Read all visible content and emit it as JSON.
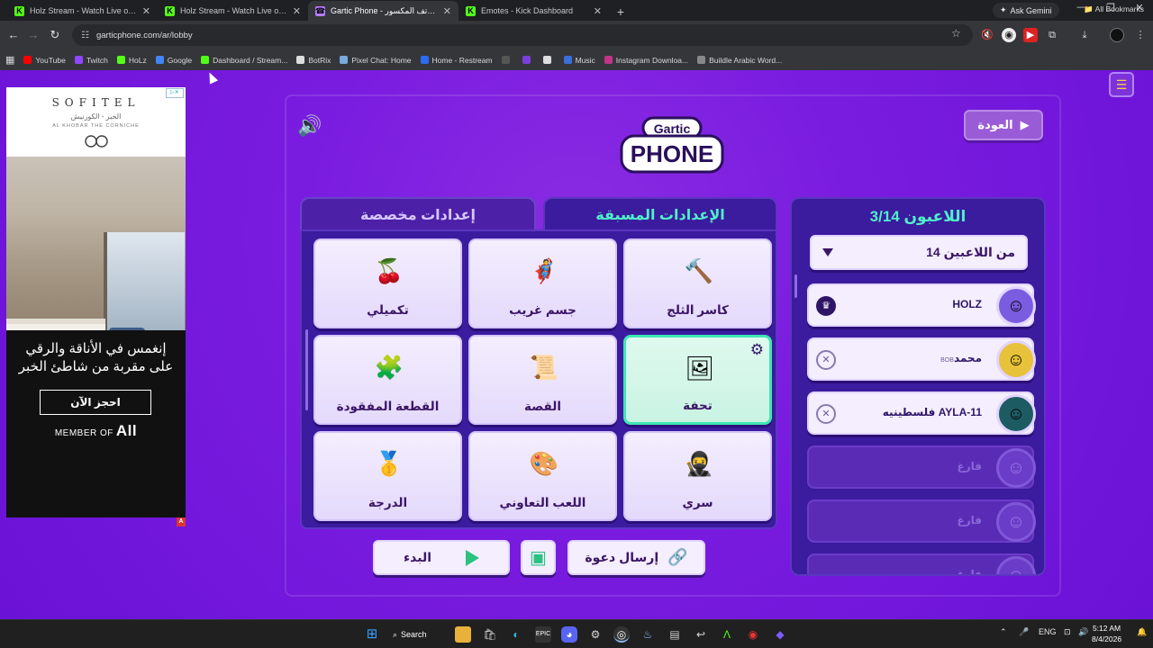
{
  "browser": {
    "tabs": [
      {
        "title": "Holz Stream - Watch Live on Ki",
        "favicon_color": "#53fc18",
        "glyph": "K",
        "active": false
      },
      {
        "title": "Holz Stream - Watch Live on Ki",
        "favicon_color": "#53fc18",
        "glyph": "K",
        "active": false
      },
      {
        "title": "Gartic Phone - الهاتف المكسور -",
        "favicon_color": "#b67cff",
        "glyph": "☎",
        "active": true
      },
      {
        "title": "Emotes - Kick Dashboard",
        "favicon_color": "#53fc18",
        "glyph": "K",
        "active": false
      }
    ],
    "new_tab": "+",
    "ask_gemini": "Ask Gemini",
    "url": "garticphone.com/ar/lobby",
    "bookmarks": [
      {
        "label": "YouTube",
        "color": "#ff0000"
      },
      {
        "label": "Twitch",
        "color": "#9146ff"
      },
      {
        "label": "HoLz",
        "color": "#53fc18"
      },
      {
        "label": "Google",
        "color": "#4285f4"
      },
      {
        "label": "Dashboard / Stream...",
        "color": "#53fc18"
      },
      {
        "label": "BotRix",
        "color": "#dddddd"
      },
      {
        "label": "Pixel Chat: Home",
        "color": "#7ad"
      },
      {
        "label": "Home - Restream",
        "color": "#2a6cf0"
      },
      {
        "label": "",
        "color": "#555555"
      },
      {
        "label": "",
        "color": "#7b3fd8"
      },
      {
        "label": "",
        "color": "#dddddd"
      },
      {
        "label": "Music",
        "color": "#3a6ed8"
      },
      {
        "label": "Instagram Downloa...",
        "color": "#c13584"
      },
      {
        "label": "Buildle Arabic Word...",
        "color": "#888888"
      }
    ],
    "all_bookmarks": "All Bookmarks"
  },
  "ad": {
    "brand": "SOFITEL",
    "brand_arabic": "الخبر - الكورنيش",
    "location": "AL KHOBAR THE CORNICHE",
    "headline_line1": "إنغمس في الأناقة والرقي",
    "headline_line2": "على مقربة من شاطئ الخبر",
    "cta": "احجز الآن",
    "member_of": "MEMBER OF",
    "member_brand": "All",
    "choice": "▷✕",
    "badge": "A"
  },
  "game": {
    "back_label": "العودة",
    "logo_top": "Gartic",
    "logo_bottom": "PHONE",
    "tab_presets": "الإعدادات المسبقة",
    "tab_custom": "إعدادات مخصصة",
    "modes": [
      {
        "label": "كاسر الثلج",
        "icon": "🔨",
        "selected": false
      },
      {
        "label": "جسم غريب",
        "icon": "🦸",
        "selected": false
      },
      {
        "label": "تكميلي",
        "icon": "🍒",
        "selected": false
      },
      {
        "label": "تحفة",
        "icon": "🖼",
        "selected": true
      },
      {
        "label": "القصة",
        "icon": "📜",
        "selected": false
      },
      {
        "label": "القطعة المفقودة",
        "icon": "🧩",
        "selected": false
      },
      {
        "label": "سري",
        "icon": "🥷",
        "selected": false
      },
      {
        "label": "اللعب التعاوني",
        "icon": "🎨",
        "selected": false
      },
      {
        "label": "الدرجة",
        "icon": "🥇",
        "selected": false
      }
    ],
    "start_label": "البدء",
    "invite_label": "إرسال دعوة",
    "players_title": "اللاعبون 3/14",
    "max_players": "14 من اللاعبين",
    "players": [
      {
        "name": "HOLZ",
        "tag": "",
        "avatar_color": "#7a5ce0",
        "host": true
      },
      {
        "name": "محمد",
        "tag": "BOB",
        "avatar_color": "#e8c23a",
        "host": false
      },
      {
        "name": "فلسطينيه AYLA-11",
        "tag": "",
        "avatar_color": "#1d5b63",
        "host": false
      }
    ],
    "empty_slot_label": "فارغ",
    "empty_slots": [
      "فارغ",
      "فارغ",
      "فارغ"
    ]
  },
  "taskbar": {
    "search": "Search",
    "lang": "ENG",
    "time": "5:12 AM",
    "date": "8/4/2026"
  }
}
